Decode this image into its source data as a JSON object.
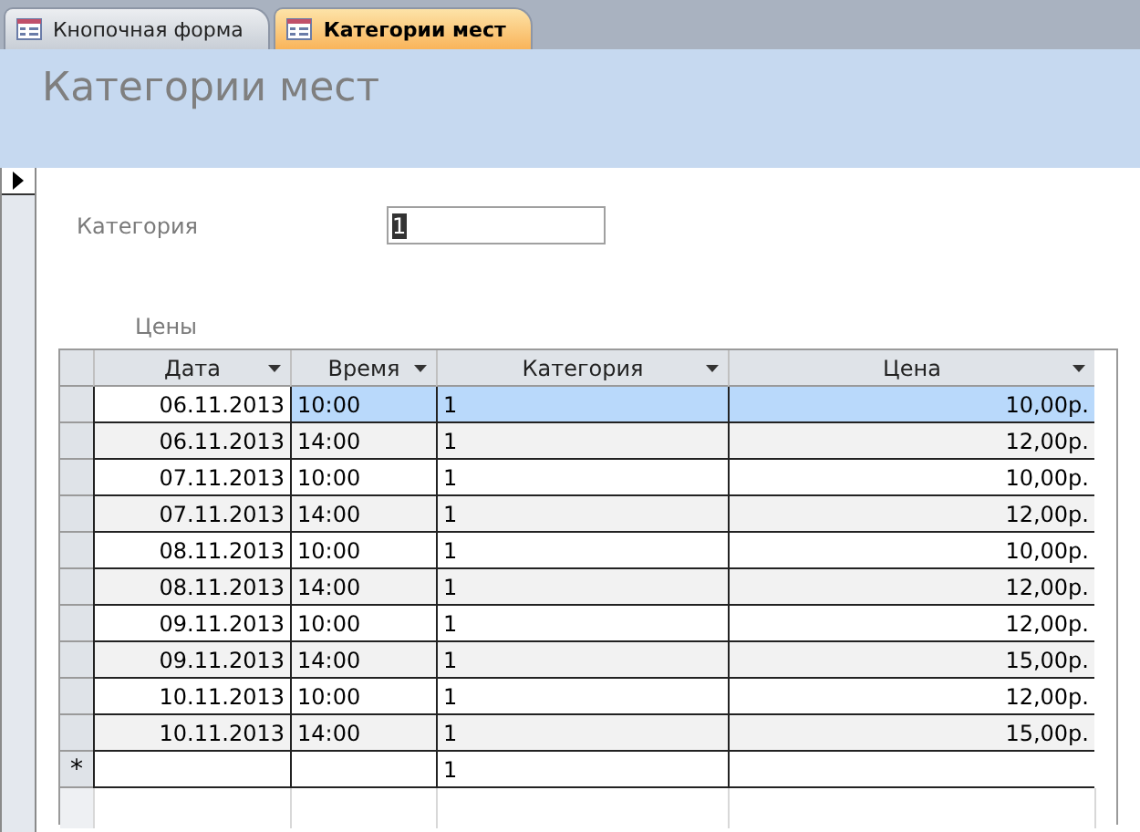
{
  "tabs": [
    {
      "label": "Кнопочная форма",
      "selected": false
    },
    {
      "label": "Категории мест",
      "selected": true
    }
  ],
  "form": {
    "title": "Категории мест",
    "field_label": "Категория",
    "field_value": "1",
    "subform_label": "Цены"
  },
  "table": {
    "columns": [
      "Дата",
      "Время",
      "Категория",
      "Цена"
    ],
    "rows": [
      {
        "kind": "data",
        "selected": true,
        "cells": [
          "06.11.2013",
          "10:00",
          "1",
          "10,00р."
        ]
      },
      {
        "kind": "data",
        "selected": false,
        "cells": [
          "06.11.2013",
          "14:00",
          "1",
          "12,00р."
        ]
      },
      {
        "kind": "data",
        "selected": false,
        "cells": [
          "07.11.2013",
          "10:00",
          "1",
          "10,00р."
        ]
      },
      {
        "kind": "data",
        "selected": false,
        "cells": [
          "07.11.2013",
          "14:00",
          "1",
          "12,00р."
        ]
      },
      {
        "kind": "data",
        "selected": false,
        "cells": [
          "08.11.2013",
          "10:00",
          "1",
          "10,00р."
        ]
      },
      {
        "kind": "data",
        "selected": false,
        "cells": [
          "08.11.2013",
          "14:00",
          "1",
          "12,00р."
        ]
      },
      {
        "kind": "data",
        "selected": false,
        "cells": [
          "09.11.2013",
          "10:00",
          "1",
          "12,00р."
        ]
      },
      {
        "kind": "data",
        "selected": false,
        "cells": [
          "09.11.2013",
          "14:00",
          "1",
          "15,00р."
        ]
      },
      {
        "kind": "data",
        "selected": false,
        "cells": [
          "10.11.2013",
          "10:00",
          "1",
          "12,00р."
        ]
      },
      {
        "kind": "data",
        "selected": false,
        "cells": [
          "10.11.2013",
          "14:00",
          "1",
          "15,00р."
        ]
      },
      {
        "kind": "new",
        "selected": false,
        "marker": "*",
        "cells": [
          "",
          "",
          "1",
          ""
        ]
      }
    ]
  }
}
